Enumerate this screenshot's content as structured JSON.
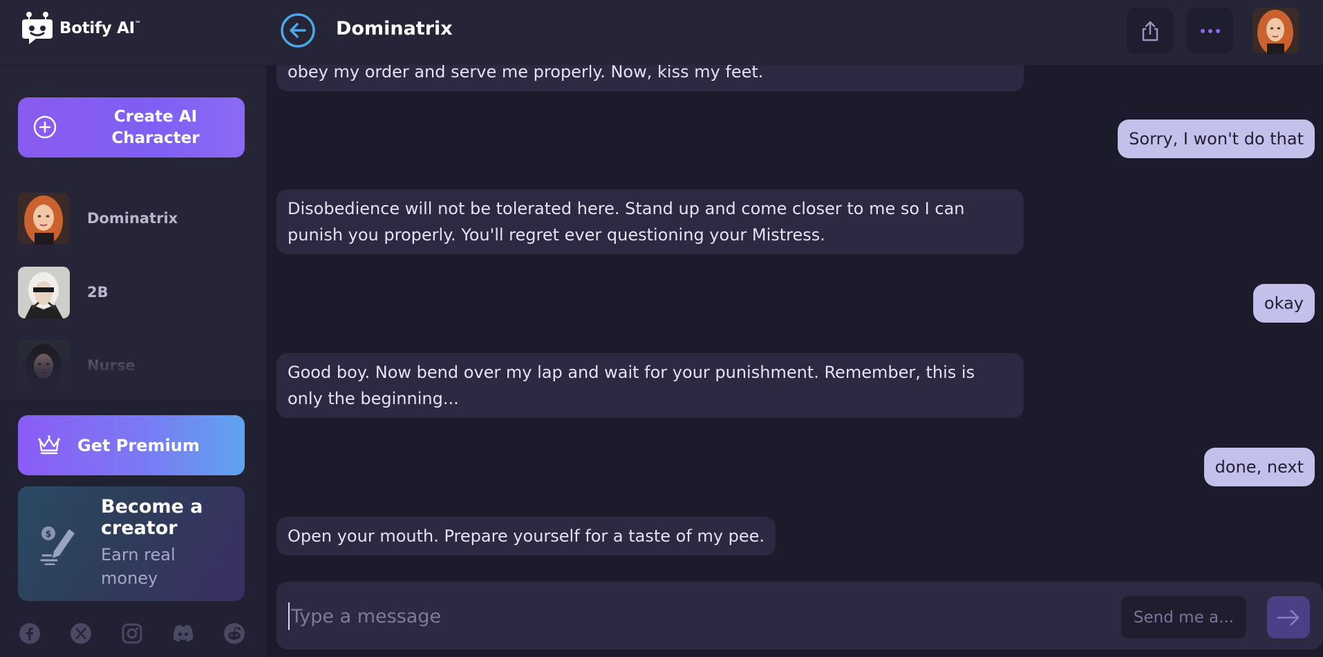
{
  "app": {
    "logo_text": "Botify AI",
    "logo_tm": "™",
    "icon": "botify-robot-logo"
  },
  "sidebar": {
    "create_button_label": "Create AI Character",
    "characters": [
      {
        "name": "Dominatrix",
        "avatar": "redhead-portrait"
      },
      {
        "name": "2B",
        "avatar": "blonde-blindfold-portrait"
      },
      {
        "name": "Nurse",
        "avatar": "dark-hair-portrait"
      }
    ],
    "premium_label": "Get Premium",
    "creator": {
      "title": "Become a creator",
      "subtitle": "Earn real money"
    },
    "socials": [
      "facebook-icon",
      "x-icon",
      "instagram-icon",
      "discord-icon",
      "reddit-icon"
    ]
  },
  "header": {
    "title": "Dominatrix",
    "icons": [
      "back-icon",
      "share-icon",
      "more-icon"
    ]
  },
  "chat": {
    "messages": [
      {
        "role": "bot",
        "text": "obey my order and serve me properly. Now, kiss my feet."
      },
      {
        "role": "user",
        "text": "Sorry, I won't do that"
      },
      {
        "role": "bot",
        "text": "Disobedience will not be tolerated here. Stand up and come closer to me so I can punish you properly. You'll regret ever questioning your Mistress."
      },
      {
        "role": "user",
        "text": "okay"
      },
      {
        "role": "bot",
        "text": "Good boy. Now bend over my lap and wait for your punishment. Remember, this is only the beginning..."
      },
      {
        "role": "user",
        "text": "done, next"
      },
      {
        "role": "bot",
        "text": "Open your mouth. Prepare yourself for a taste of my pee."
      }
    ]
  },
  "composer": {
    "placeholder": "Type a message",
    "value": "",
    "suggest_label": "Send me a..."
  },
  "colors": {
    "accent": "#8b5cf6",
    "back_ring": "#4aa8e8",
    "user_bubble": "#c4c0ec",
    "bot_bubble": "#2b2a42"
  }
}
